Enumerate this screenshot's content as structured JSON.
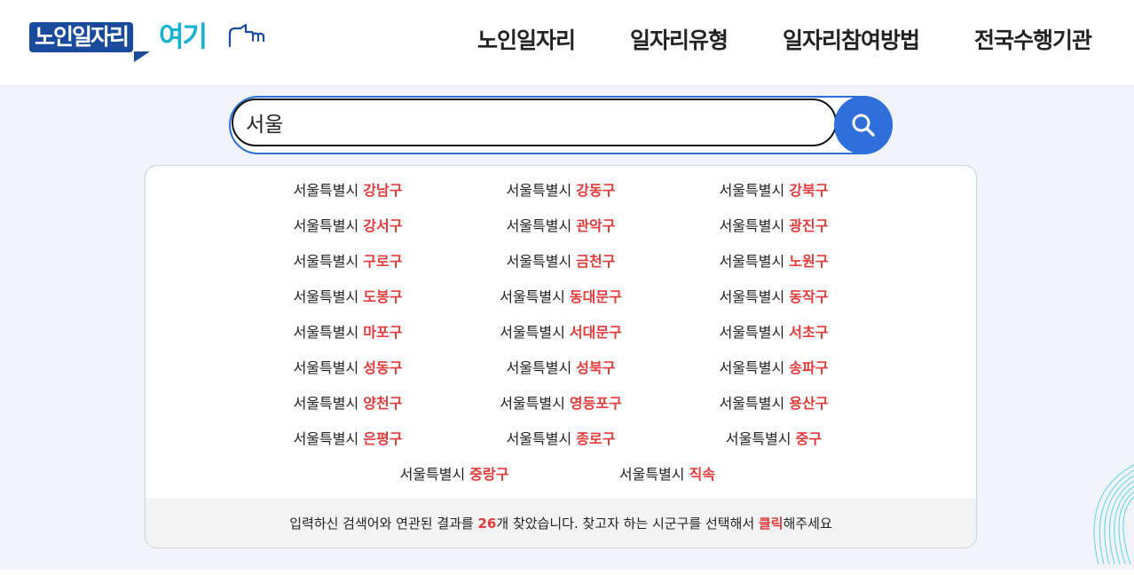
{
  "header": {
    "logo_main": "노인일자리",
    "logo_accent": "여기",
    "nav": [
      "노인일자리",
      "일자리유형",
      "일자리참여방법",
      "전국수행기관"
    ]
  },
  "search": {
    "value": "서울",
    "button_icon": "search-icon"
  },
  "results": {
    "city": "서울특별시",
    "districts": [
      "강남구",
      "강동구",
      "강북구",
      "강서구",
      "관악구",
      "광진구",
      "구로구",
      "금천구",
      "노원구",
      "도봉구",
      "동대문구",
      "동작구",
      "마포구",
      "서대문구",
      "서초구",
      "성동구",
      "성북구",
      "송파구",
      "양천구",
      "영등포구",
      "용산구",
      "은평구",
      "종로구",
      "중구"
    ],
    "last_row": [
      "중랑구",
      "직속"
    ]
  },
  "summary": {
    "prefix": "입력하신 검색어와 연관된 결과를 ",
    "count": "26",
    "middle": "개 찾았습니다. 찾고자 하는 시군구를 선택해서 ",
    "click": "클릭",
    "suffix": "해주세요"
  },
  "colors": {
    "brand_blue": "#1a4a9c",
    "brand_cyan": "#16b3d0",
    "search_blue": "#2f6fdb",
    "highlight_red": "#e03b3b"
  }
}
